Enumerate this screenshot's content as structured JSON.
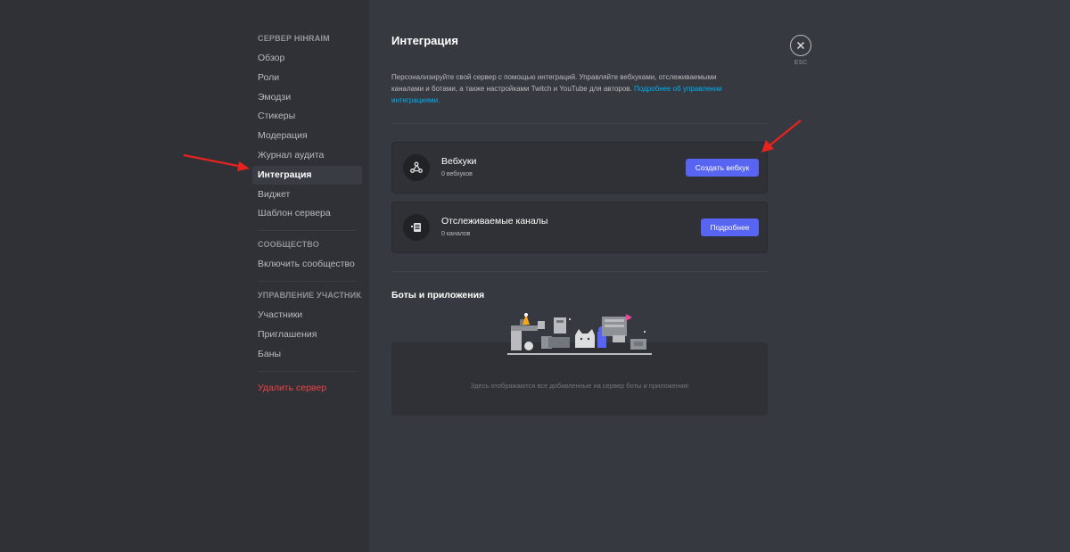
{
  "sidebar": {
    "server_header_prefix": "Сервер",
    "server_name": "HIHRAIM",
    "server_items": [
      {
        "label": "Обзор"
      },
      {
        "label": "Роли"
      },
      {
        "label": "Эмодзи"
      },
      {
        "label": "Стикеры"
      },
      {
        "label": "Модерация"
      },
      {
        "label": "Журнал аудита"
      },
      {
        "label": "Интеграция",
        "active": true
      },
      {
        "label": "Виджет"
      },
      {
        "label": "Шаблон сервера"
      }
    ],
    "community_header": "Сообщество",
    "community_items": [
      {
        "label": "Включить сообщество"
      }
    ],
    "members_header": "Управление участника...",
    "members_items": [
      {
        "label": "Участники"
      },
      {
        "label": "Приглашения"
      },
      {
        "label": "Баны"
      }
    ],
    "delete_label": "Удалить сервер"
  },
  "main": {
    "title": "Интеграция",
    "description": "Персонализируйте свой сервер с помощью интеграций. Управляйте вебхуками, отслеживаемыми каналами и ботами, а также настройками Twitch и YouTube для авторов.",
    "description_link": "Подробнее об управлении интеграциями.",
    "webhooks": {
      "title": "Вебхуки",
      "count": "0 вебхуков",
      "button": "Создать вебхук",
      "icon": "webhook-icon"
    },
    "followed": {
      "title": "Отслеживаемые каналы",
      "count": "0 каналов",
      "button": "Подробнее",
      "icon": "followed-channel-icon"
    },
    "bots_title": "Боты и приложения",
    "bots_empty": "Здесь отображаются все добавленные на сервер боты и приложения!"
  },
  "close": {
    "label": "ESC",
    "icon": "close-icon"
  },
  "colors": {
    "accent": "#5865f2",
    "link": "#00aff4",
    "danger": "#ed4245",
    "annotation_arrow": "#e8231f"
  }
}
